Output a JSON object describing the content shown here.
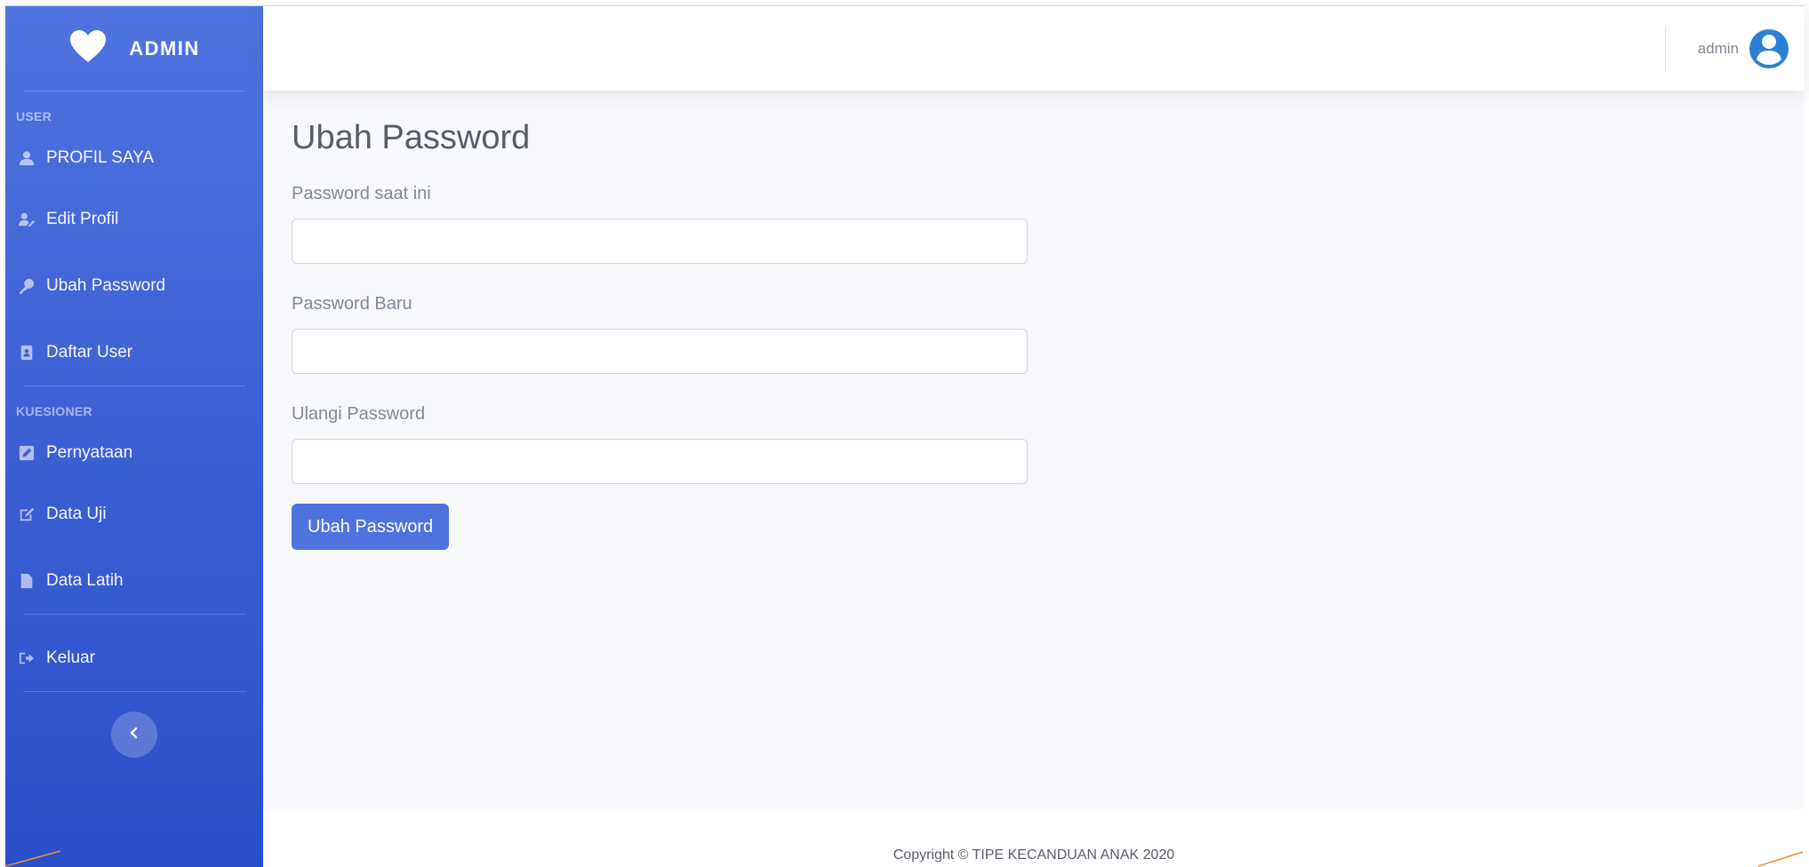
{
  "sidebar": {
    "brand": "ADMIN",
    "sections": [
      {
        "heading": "USER"
      },
      {
        "heading": "KUESIONER"
      }
    ],
    "items": [
      {
        "label": "PROFIL SAYA",
        "icon": "user-icon"
      },
      {
        "label": "Edit Profil",
        "icon": "user-edit-icon"
      },
      {
        "label": "Ubah Password",
        "icon": "key-icon"
      },
      {
        "label": "Daftar User",
        "icon": "address-book-icon"
      },
      {
        "label": "Pernyataan",
        "icon": "edit-square-icon"
      },
      {
        "label": "Data Uji",
        "icon": "pencil-square-icon"
      },
      {
        "label": "Data Latih",
        "icon": "file-icon"
      },
      {
        "label": "Keluar",
        "icon": "sign-out-icon"
      }
    ]
  },
  "topbar": {
    "user_name": "admin"
  },
  "main": {
    "title": "Ubah Password",
    "fields": [
      {
        "label": "Password saat ini",
        "value": ""
      },
      {
        "label": "Password Baru",
        "value": ""
      },
      {
        "label": "Ulangi Password",
        "value": ""
      }
    ],
    "submit_label": "Ubah Password"
  },
  "footer": {
    "text": "Copyright © TIPE KECANDUAN ANAK 2020"
  },
  "colors": {
    "primary": "#4e73df",
    "sidebar_dark": "#2a4fc9",
    "page_bg": "#f8f9fc",
    "avatar": "#2d7fd6"
  }
}
